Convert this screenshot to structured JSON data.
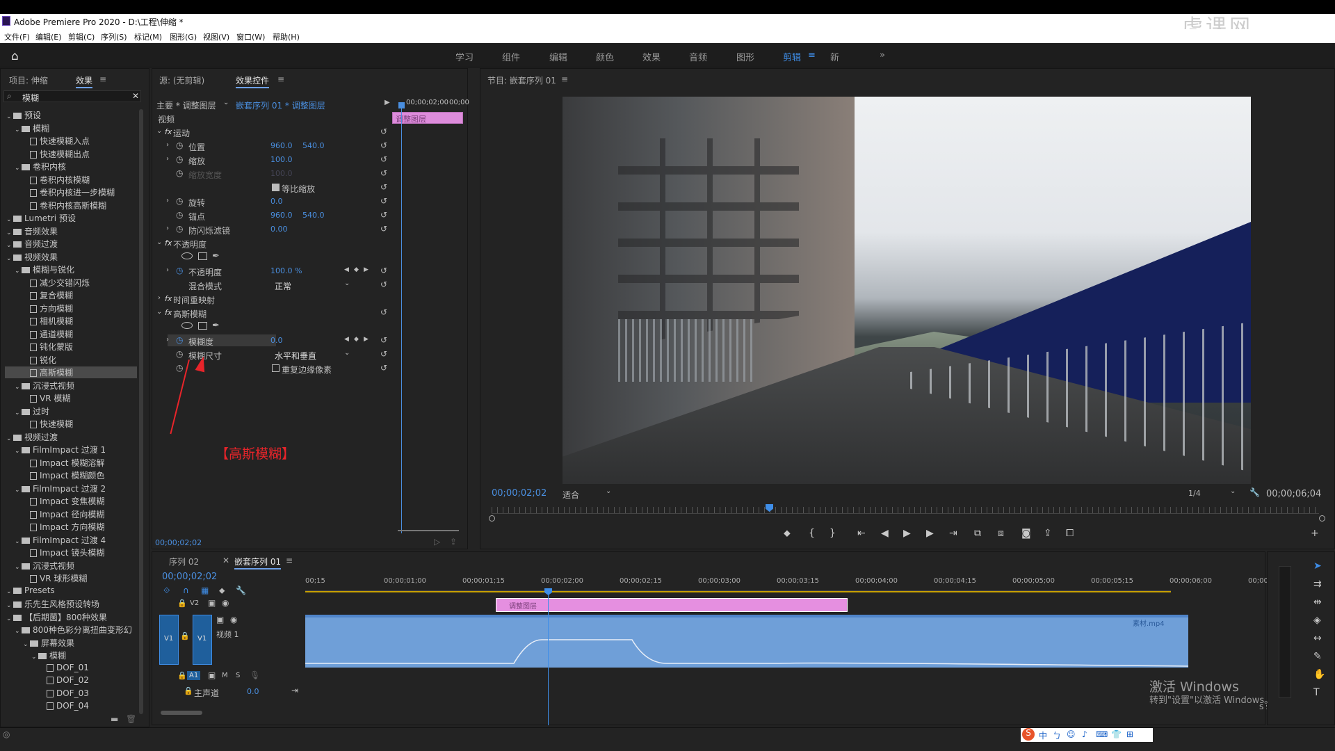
{
  "app": {
    "title": "Adobe Premiere Pro 2020 - D:\\工程\\伸缩 *"
  },
  "menu": [
    "文件(F)",
    "编辑(E)",
    "剪辑(C)",
    "序列(S)",
    "标记(M)",
    "图形(G)",
    "视图(V)",
    "窗口(W)",
    "帮助(H)"
  ],
  "workspaces": [
    "学习",
    "组件",
    "编辑",
    "颜色",
    "效果",
    "音频",
    "图形",
    "剪辑",
    "新"
  ],
  "workspace_active": "剪辑",
  "watermark": "虎课网",
  "project": {
    "tab_project": "项目: 伸缩",
    "tab_effects": "效果",
    "search": "模糊",
    "tree": [
      {
        "label": "预设",
        "level": 0,
        "type": "folder"
      },
      {
        "label": "模糊",
        "level": 1,
        "type": "folder"
      },
      {
        "label": "快速模糊入点",
        "level": 2,
        "type": "fx"
      },
      {
        "label": "快速模糊出点",
        "level": 2,
        "type": "fx"
      },
      {
        "label": "卷积内核",
        "level": 1,
        "type": "folder"
      },
      {
        "label": "卷积内核模糊",
        "level": 2,
        "type": "fx"
      },
      {
        "label": "卷积内核进一步模糊",
        "level": 2,
        "type": "fx"
      },
      {
        "label": "卷积内核高斯模糊",
        "level": 2,
        "type": "fx"
      },
      {
        "label": "Lumetri 预设",
        "level": 0,
        "type": "folder"
      },
      {
        "label": "音频效果",
        "level": 0,
        "type": "folder"
      },
      {
        "label": "音频过渡",
        "level": 0,
        "type": "folder"
      },
      {
        "label": "视频效果",
        "level": 0,
        "type": "folder"
      },
      {
        "label": "模糊与锐化",
        "level": 1,
        "type": "folder"
      },
      {
        "label": "减少交错闪烁",
        "level": 2,
        "type": "fx"
      },
      {
        "label": "复合模糊",
        "level": 2,
        "type": "fx"
      },
      {
        "label": "方向模糊",
        "level": 2,
        "type": "fx"
      },
      {
        "label": "相机模糊",
        "level": 2,
        "type": "fx"
      },
      {
        "label": "通道模糊",
        "level": 2,
        "type": "fx"
      },
      {
        "label": "钝化蒙版",
        "level": 2,
        "type": "fx"
      },
      {
        "label": "锐化",
        "level": 2,
        "type": "fx"
      },
      {
        "label": "高斯模糊",
        "level": 2,
        "type": "fx",
        "selected": true
      },
      {
        "label": "沉浸式视频",
        "level": 1,
        "type": "folder"
      },
      {
        "label": "VR 模糊",
        "level": 2,
        "type": "fx"
      },
      {
        "label": "过时",
        "level": 1,
        "type": "folder"
      },
      {
        "label": "快速模糊",
        "level": 2,
        "type": "fx"
      },
      {
        "label": "视频过渡",
        "level": 0,
        "type": "folder"
      },
      {
        "label": "FilmImpact 过渡 1",
        "level": 1,
        "type": "folder"
      },
      {
        "label": "Impact 模糊溶解",
        "level": 2,
        "type": "fx"
      },
      {
        "label": "Impact 模糊颜色",
        "level": 2,
        "type": "fx"
      },
      {
        "label": "FilmImpact 过渡 2",
        "level": 1,
        "type": "folder"
      },
      {
        "label": "Impact 变焦模糊",
        "level": 2,
        "type": "fx"
      },
      {
        "label": "Impact 径向模糊",
        "level": 2,
        "type": "fx"
      },
      {
        "label": "Impact 方向模糊",
        "level": 2,
        "type": "fx"
      },
      {
        "label": "FilmImpact 过渡 4",
        "level": 1,
        "type": "folder"
      },
      {
        "label": "Impact 镜头模糊",
        "level": 2,
        "type": "fx"
      },
      {
        "label": "沉浸式视频",
        "level": 1,
        "type": "folder"
      },
      {
        "label": "VR 球形模糊",
        "level": 2,
        "type": "fx"
      },
      {
        "label": "Presets",
        "level": 0,
        "type": "folder"
      },
      {
        "label": "乐先生风格预设转场",
        "level": 0,
        "type": "folder"
      },
      {
        "label": "【后期菌】800种效果",
        "level": 0,
        "type": "folder"
      },
      {
        "label": "800种色彩分离扭曲变形幻",
        "level": 1,
        "type": "folder"
      },
      {
        "label": "屏幕效果",
        "level": 2,
        "type": "folder"
      },
      {
        "label": "模糊",
        "level": 3,
        "type": "folder"
      },
      {
        "label": "DOF_01",
        "level": 4,
        "type": "fx"
      },
      {
        "label": "DOF_02",
        "level": 4,
        "type": "fx"
      },
      {
        "label": "DOF_03",
        "level": 4,
        "type": "fx"
      },
      {
        "label": "DOF_04",
        "level": 4,
        "type": "fx"
      }
    ]
  },
  "effect_controls": {
    "tab_source": "源: (无剪辑)",
    "tab_ec": "效果控件",
    "master": "主要 * 调整图层",
    "seq": "嵌套序列 01 * 调整图层",
    "mini_time": "00;00;02;00",
    "mini_time2": "00;00",
    "mini_clip": "调整图层",
    "video_label": "视频",
    "motion": "运动",
    "position": "位置",
    "pos_x": "960.0",
    "pos_y": "540.0",
    "scale": "缩放",
    "scale_val": "100.0",
    "scale_w": "缩放宽度",
    "scale_w_val": "100.0",
    "uniform": "等比缩放",
    "rotation": "旋转",
    "rotation_val": "0.0",
    "anchor": "锚点",
    "anc_x": "960.0",
    "anc_y": "540.0",
    "flicker": "防闪烁滤镜",
    "flicker_val": "0.00",
    "opacity_group": "不透明度",
    "opacity": "不透明度",
    "opacity_val": "100.0 %",
    "blend": "混合模式",
    "blend_val": "正常",
    "time_remap": "时间重映射",
    "gauss": "高斯模糊",
    "blurriness": "模糊度",
    "blurriness_val": "0.0",
    "blur_dim": "模糊尺寸",
    "blur_dim_val": "水平和垂直",
    "repeat_edge": "重复边缘像素",
    "annotation": "【高斯模糊】",
    "timecode": "00;00;02;02"
  },
  "program": {
    "title": "节目: 嵌套序列 01",
    "timecode": "00;00;02;02",
    "fit": "适合",
    "res": "1/4",
    "duration": "00;00;06;04"
  },
  "timeline": {
    "tab1": "序列 02",
    "tab2": "嵌套序列 01",
    "timecode": "00;00;02;02",
    "ruler": [
      "00;15",
      "00;00;01;00",
      "00;00;01;15",
      "00;00;02;00",
      "00;00;02;15",
      "00;00;03;00",
      "00;00;03;15",
      "00;00;04;00",
      "00;00;04;15",
      "00;00;05;00",
      "00;00;05;15",
      "00;00;06;00",
      "00;00;0"
    ],
    "v2": "V2",
    "v1": "V1",
    "v1_src": "V1",
    "v1_name": "视频 1",
    "a1": "A1",
    "m": "M",
    "s": "S",
    "master": "主声道",
    "master_val": "0.0",
    "clip_adj": "调整图层",
    "clip_video": "素材.mp4",
    "meter": "S S"
  },
  "activation": {
    "line1": "激活 Windows",
    "line2": "转到\"设置\"以激活 Windows。"
  },
  "ime": [
    "中",
    "ㄅ",
    "☺",
    "♪",
    "⌨",
    "👕",
    "⊞"
  ]
}
